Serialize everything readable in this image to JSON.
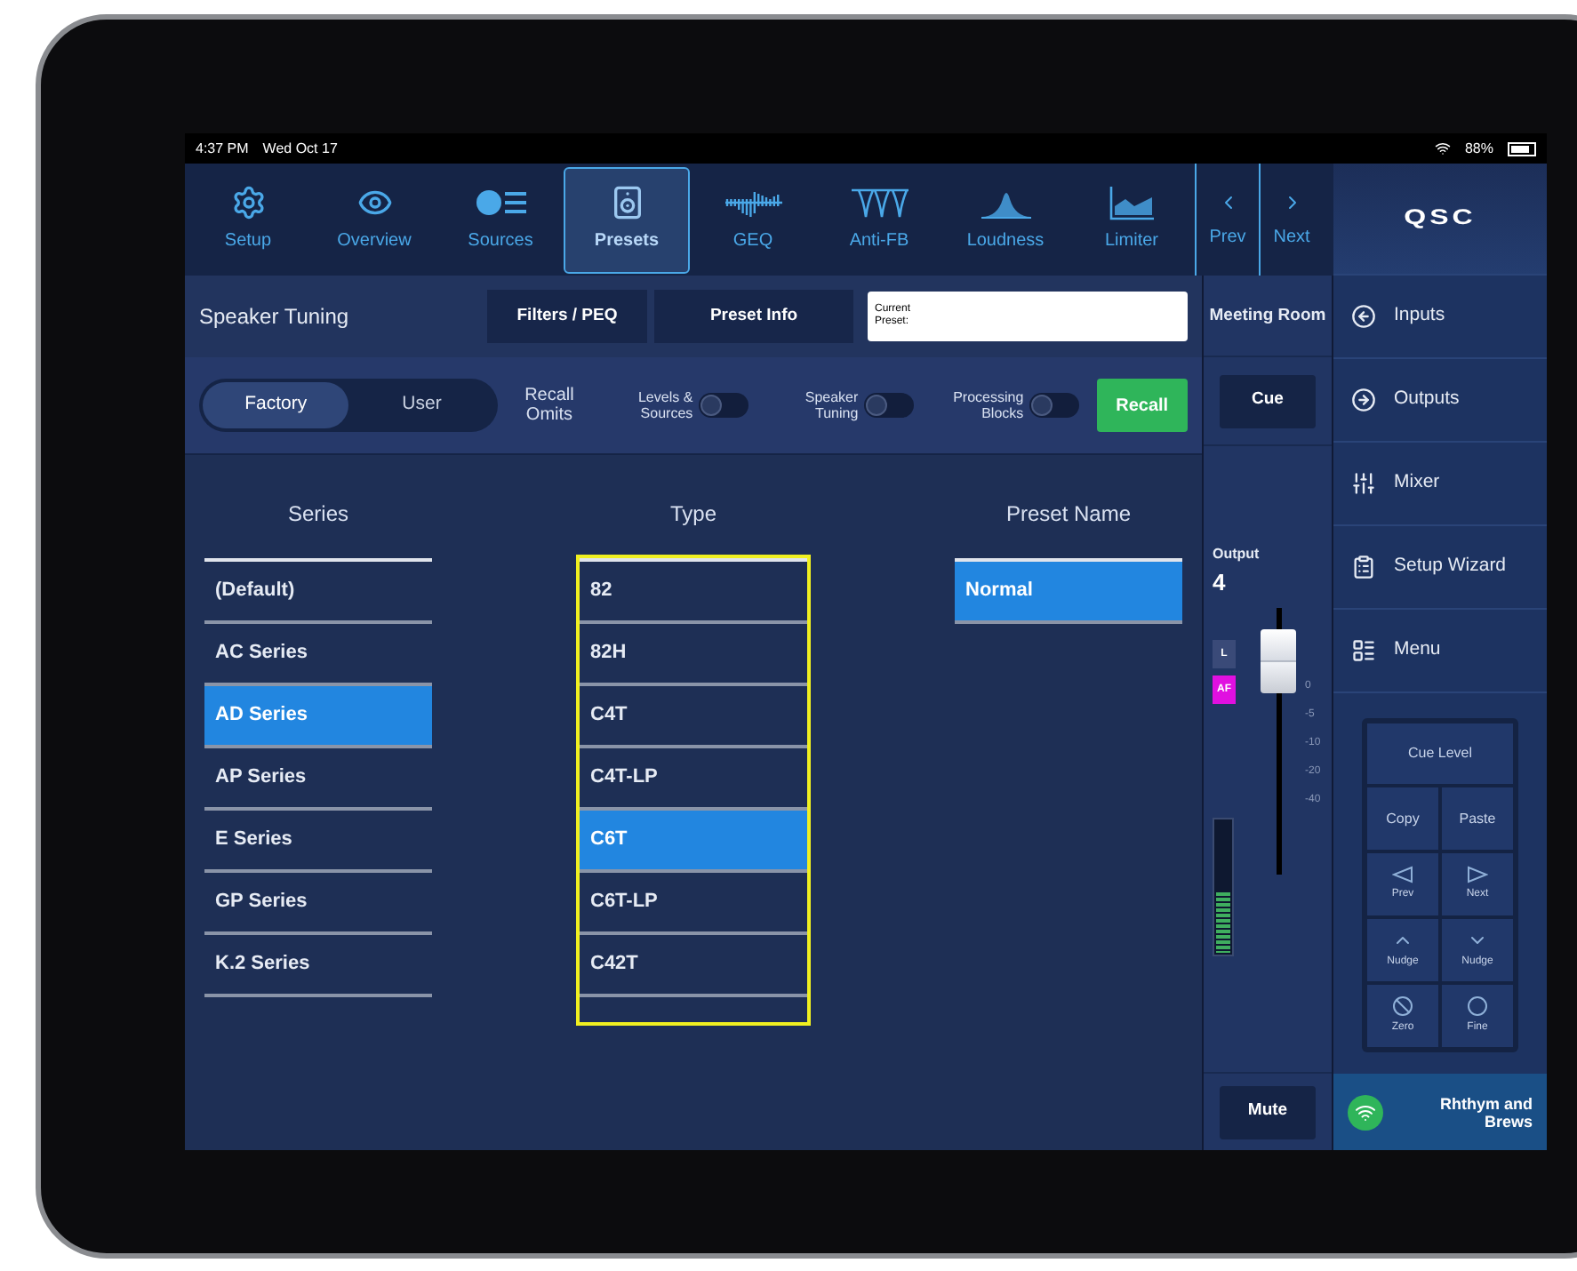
{
  "status_bar": {
    "time": "4:37 PM",
    "date": "Wed Oct 17",
    "battery": "88%"
  },
  "tabs": [
    {
      "label": "Setup",
      "selected": false
    },
    {
      "label": "Overview",
      "selected": false
    },
    {
      "label": "Sources",
      "selected": false
    },
    {
      "label": "Presets",
      "selected": true
    },
    {
      "label": "GEQ",
      "selected": false
    },
    {
      "label": "Anti-FB",
      "selected": false
    },
    {
      "label": "Loudness",
      "selected": false
    },
    {
      "label": "Limiter",
      "selected": false
    }
  ],
  "nav_buttons": [
    "Prev",
    "Next"
  ],
  "toolbar": {
    "title": "Speaker Tuning",
    "buttons": [
      "Filters / PEQ",
      "Preset Info"
    ],
    "current_preset_label": "Current Preset:"
  },
  "mode_toggle": [
    {
      "label": "Factory",
      "selected": true
    },
    {
      "label": "User",
      "selected": false
    }
  ],
  "recall_omits": {
    "label": "Recall Omits",
    "switches": [
      {
        "label": "Levels & Sources",
        "on": false
      },
      {
        "label": "Speaker Tuning",
        "on": false
      },
      {
        "label": "Processing Blocks",
        "on": false
      }
    ],
    "recall_button": "Recall"
  },
  "lists": [
    {
      "header": "Series",
      "items": [
        {
          "label": "(Default)",
          "selected": false
        },
        {
          "label": "AC Series",
          "selected": false
        },
        {
          "label": "AD Series",
          "selected": true
        },
        {
          "label": "AP Series",
          "selected": false
        },
        {
          "label": "E Series",
          "selected": false
        },
        {
          "label": "GP Series",
          "selected": false
        },
        {
          "label": "K.2 Series",
          "selected": false
        }
      ]
    },
    {
      "header": "Type",
      "focused": true,
      "items": [
        {
          "label": "82",
          "selected": false
        },
        {
          "label": "82H",
          "selected": false
        },
        {
          "label": "C4T",
          "selected": false
        },
        {
          "label": "C4T-LP",
          "selected": false
        },
        {
          "label": "C6T",
          "selected": true
        },
        {
          "label": "C6T-LP",
          "selected": false
        },
        {
          "label": "C42T",
          "selected": false
        }
      ]
    },
    {
      "header": "Preset Name",
      "focused": false,
      "items": [
        {
          "label": "Normal",
          "selected": true
        }
      ]
    }
  ],
  "channel": {
    "name": "Meeting Room",
    "cue": "Cue",
    "output_label": "Output",
    "output_number": "4",
    "badges": [
      {
        "label": "L",
        "color": "#3a4a78"
      },
      {
        "label": "AF",
        "color": "#e010e0"
      }
    ],
    "fader": {
      "level": 0.8,
      "scale": [
        "0",
        "-5",
        "-10",
        "-20",
        "-40"
      ]
    },
    "meter": {
      "level": 0.45
    },
    "mute": "Mute"
  },
  "sidebar": {
    "logo": "QSC",
    "items": [
      "Inputs",
      "Outputs",
      "Mixer",
      "Setup Wizard",
      "Menu"
    ]
  },
  "keypad": {
    "title": "Cue Level",
    "keys": [
      {
        "label": "Copy",
        "kind": "text"
      },
      {
        "label": "Paste",
        "kind": "text"
      },
      {
        "label": "Prev",
        "kind": "left"
      },
      {
        "label": "Next",
        "kind": "right"
      },
      {
        "label": "Nudge",
        "kind": "up"
      },
      {
        "label": "Nudge",
        "kind": "down"
      },
      {
        "label": "Zero",
        "kind": "zero"
      },
      {
        "label": "Fine",
        "kind": "fine"
      }
    ]
  },
  "network": {
    "name": "Rhthym and Brews"
  }
}
